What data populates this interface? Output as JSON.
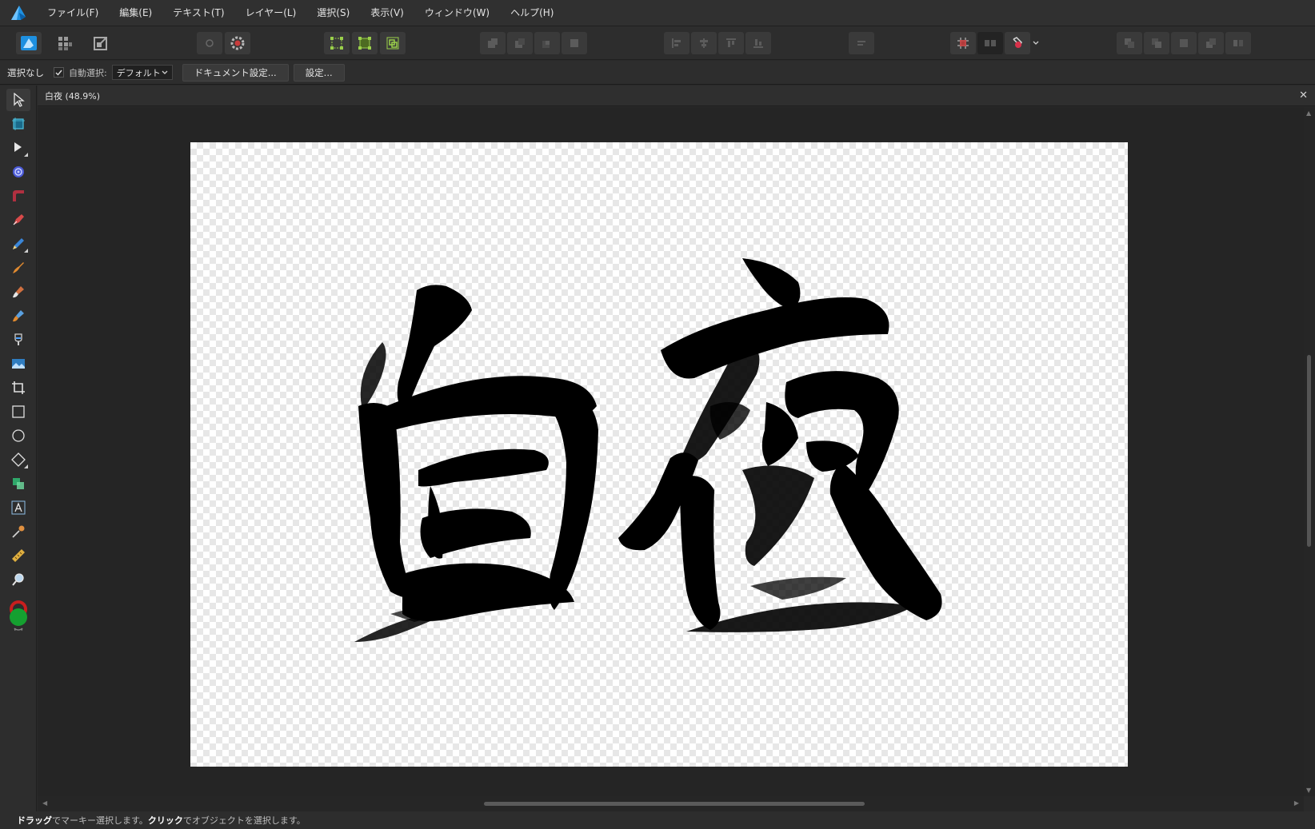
{
  "menubar": {
    "items": [
      "ファイル(F)",
      "編集(E)",
      "テキスト(T)",
      "レイヤー(L)",
      "選択(S)",
      "表示(V)",
      "ウィンドウ(W)",
      "ヘルプ(H)"
    ]
  },
  "context": {
    "selection_label": "選択なし",
    "auto_select_label": "自動選択:",
    "auto_select_checked": true,
    "auto_select_value": "デフォルト",
    "document_setup_button": "ドキュメント設定...",
    "settings_button": "設定..."
  },
  "document": {
    "tab_title": "白夜 (48.9%)",
    "close_glyph": "✕"
  },
  "status": {
    "drag": "ドラッグ",
    "text1": "でマーキー選択します。",
    "click": "クリック",
    "text2": "でオブジェクトを選択します。"
  },
  "colors": {
    "accent": "#1e90e0",
    "primary_fill": "#c81e1e",
    "secondary_fill": "#15a030",
    "ink": "#000000"
  }
}
